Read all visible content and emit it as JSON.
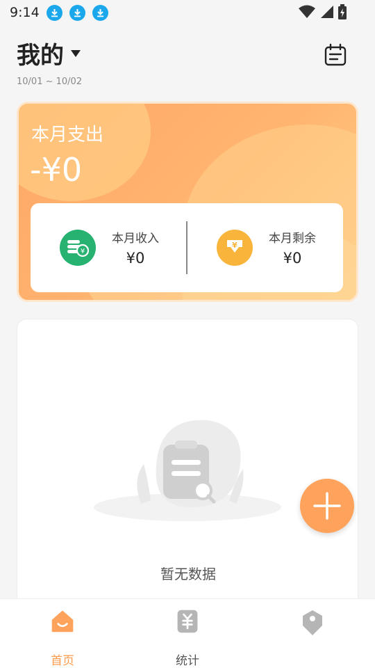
{
  "status_bar": {
    "time": "9:14",
    "notification_icons": [
      "download-icon",
      "download-icon",
      "download-icon"
    ],
    "system_icons": [
      "wifi-icon",
      "signal-icon",
      "battery-icon"
    ]
  },
  "header": {
    "title": "我的",
    "date_range": "10/01 ~ 10/02",
    "calendar_icon": "calendar-icon"
  },
  "summary": {
    "label": "本月支出",
    "amount": "-¥0",
    "income": {
      "label": "本月收入",
      "value": "¥0",
      "icon": "coins-icon"
    },
    "remaining": {
      "label": "本月剩余",
      "value": "¥0",
      "icon": "yen-down-icon"
    }
  },
  "empty_state": {
    "text": "暂无数据",
    "icon": "empty-clipboard-icon"
  },
  "fab": {
    "icon": "plus-icon"
  },
  "tabs": [
    {
      "label": "首页",
      "icon": "home-icon",
      "active": true
    },
    {
      "label": "统计",
      "icon": "yen-receipt-icon",
      "active": false
    },
    {
      "label": "",
      "icon": "tag-icon",
      "active": false
    }
  ],
  "colors": {
    "accent": "#ffa35c",
    "card_gradient_start": "#ffa766",
    "income_icon_bg": "#27b272",
    "remaining_icon_bg": "#f9b53b",
    "status_download_bg": "#1aa7ec"
  }
}
